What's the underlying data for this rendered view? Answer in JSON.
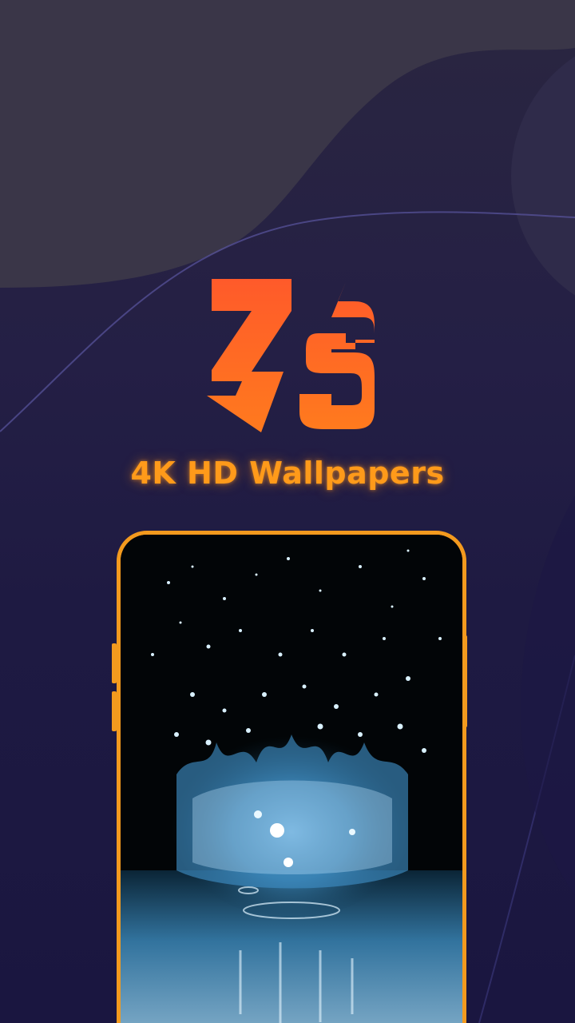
{
  "app": {
    "logo_text": "ZS",
    "tagline": "4K HD Wallpapers"
  },
  "icons": {
    "logo": "zs-logo-icon"
  },
  "preview": {
    "content": "water-splash"
  },
  "colors": {
    "accent": "#ff9a1a",
    "logo_gradient_top": "#ff5a2a",
    "logo_gradient_bottom": "#ff7a1e",
    "background_top": "#2a2640",
    "background_bottom": "#1a1640",
    "phone_frame": "#f39a1e",
    "water": "#6fb8e8"
  }
}
